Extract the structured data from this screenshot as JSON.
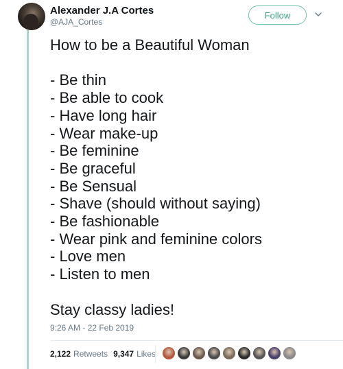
{
  "tweet": {
    "author": {
      "display_name": "Alexander J.A Cortes",
      "handle": "@AJA_Cortes"
    },
    "follow_label": "Follow",
    "text": "How to be a Beautiful Woman\n\n- Be thin\n- Be able to cook\n- Have long hair\n- Wear make-up\n- Be feminine\n- Be graceful\n- Be Sensual\n- Shave (should without saying)\n- Be fashionable\n- Wear pink and feminine colors\n- Love men\n- Listen to men\n\nStay classy ladies!",
    "timestamp": "9:26 AM - 22 Feb 2019",
    "stats": {
      "retweets_count": "2,122",
      "retweets_label": "Retweets",
      "likes_count": "9,347",
      "likes_label": "Likes"
    }
  },
  "icons": {
    "caret": "chevron-down-icon"
  },
  "colors": {
    "thread_line": "#a3dcc6",
    "follow_accent": "#3ea37f",
    "secondary_text": "#657786",
    "liker_avatars": [
      "#b5583c",
      "#3a3a3a",
      "#6b5a4e",
      "#4a4a4a",
      "#7a6a5a",
      "#2b2b2b",
      "#555555",
      "#4b3f6b",
      "#8a8a8a"
    ]
  }
}
